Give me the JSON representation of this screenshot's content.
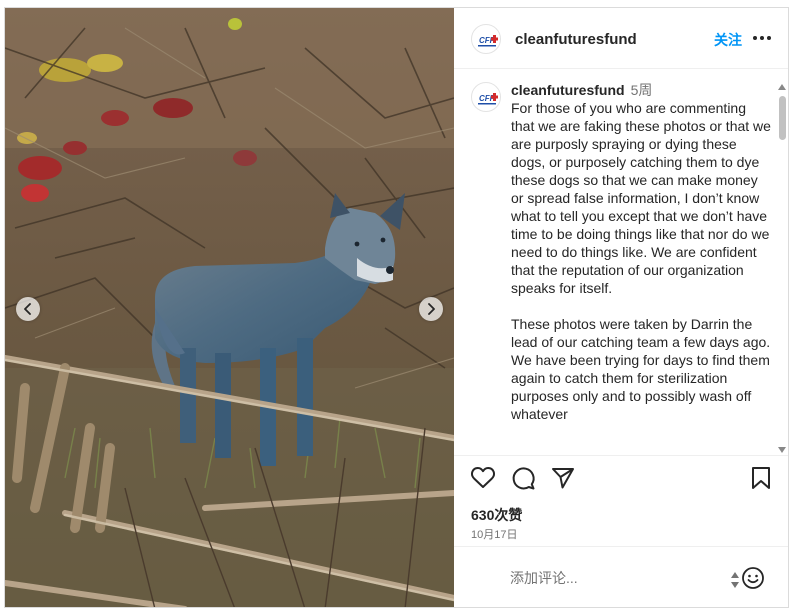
{
  "post": {
    "username": "cleanfuturesfund",
    "follow_label": "关注",
    "avatar_text": "CFF",
    "caption": {
      "username": "cleanfuturesfund",
      "time": "5周",
      "paragraph_1": "For those of you who are commenting that we are faking these photos or that we are purposly spraying or dying these dogs, or purposely catching them to dye these dogs so that we can make money or spread false information, I don’t know what to tell you except that we don’t have time to be doing things like that nor do we need to do things like. We are confident that the reputation of our organization speaks for itself.",
      "paragraph_2": "These photos were taken by Darrin the lead of our catching team a few days ago. We have been trying for days to find them again to catch them for sterilization purposes only and to possibly wash off whatever"
    },
    "likes": "630次赞",
    "date": "10月17日",
    "comment_placeholder": "添加评论..."
  },
  "icons": {
    "more": "more-horizontal-icon",
    "like": "heart-icon",
    "comment": "comment-bubble-icon",
    "share": "paper-plane-icon",
    "save": "bookmark-icon",
    "emoji": "smiley-face-icon",
    "prev": "chevron-left-icon",
    "next": "chevron-right-icon"
  },
  "colors": {
    "accent": "#0095f6",
    "text": "#262626",
    "secondary": "#737373",
    "dog_fur": "#4f6a80"
  }
}
